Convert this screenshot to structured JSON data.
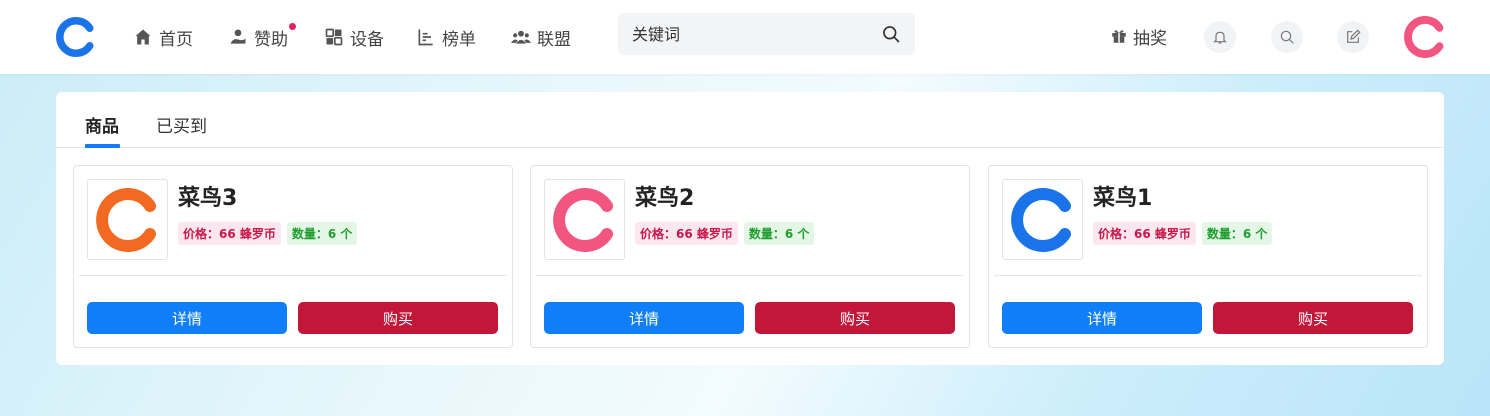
{
  "header": {
    "nav": [
      {
        "label": "首页",
        "icon": "home-icon"
      },
      {
        "label": "赞助",
        "icon": "sponsor-icon",
        "has_dot": true
      },
      {
        "label": "设备",
        "icon": "devices-icon"
      },
      {
        "label": "榜单",
        "icon": "ranking-icon"
      },
      {
        "label": "联盟",
        "icon": "alliance-icon"
      }
    ],
    "search": {
      "placeholder": "关键词"
    },
    "lottery_label": "抽奖"
  },
  "tabs": [
    {
      "label": "商品",
      "active": true
    },
    {
      "label": "已买到",
      "active": false
    }
  ],
  "products": [
    {
      "name": "菜鸟3",
      "price": "价格：66 蜂罗币",
      "qty": "数量：6 个",
      "color": "#f26a21",
      "detail_label": "详情",
      "buy_label": "购买"
    },
    {
      "name": "菜鸟2",
      "price": "价格：66 蜂罗币",
      "qty": "数量：6 个",
      "color": "#f2557f",
      "detail_label": "详情",
      "buy_label": "购买"
    },
    {
      "name": "菜鸟1",
      "price": "价格：66 蜂罗币",
      "qty": "数量：6 个",
      "color": "#1a73e8",
      "detail_label": "详情",
      "buy_label": "购买"
    }
  ],
  "colors": {
    "accent": "#0f7ef7",
    "buy": "#c3173a",
    "logo": "#1a73e8",
    "avatar": "#f2557f"
  }
}
